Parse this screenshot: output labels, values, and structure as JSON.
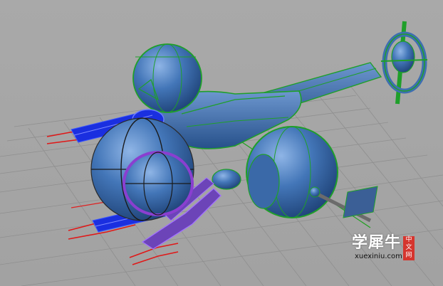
{
  "viewport": {
    "background_color": "#a5a5a5",
    "grid_color": "#8e8e8e",
    "axis_x_color": "#e02020",
    "axis_y_color": "#20a020"
  },
  "model": {
    "shaded_color": "#3d6fb0",
    "edge_color": "#1f9f2a",
    "selected_blue_color": "#1a2fe0",
    "selected_purple_color": "#8a3fd0",
    "selected_red_color": "#e01818"
  },
  "watermark": {
    "brand": "学犀牛",
    "url": "xuexiniu.com",
    "badge_chars": [
      "中",
      "文",
      "网"
    ],
    "badge_color": "#d5352e"
  }
}
